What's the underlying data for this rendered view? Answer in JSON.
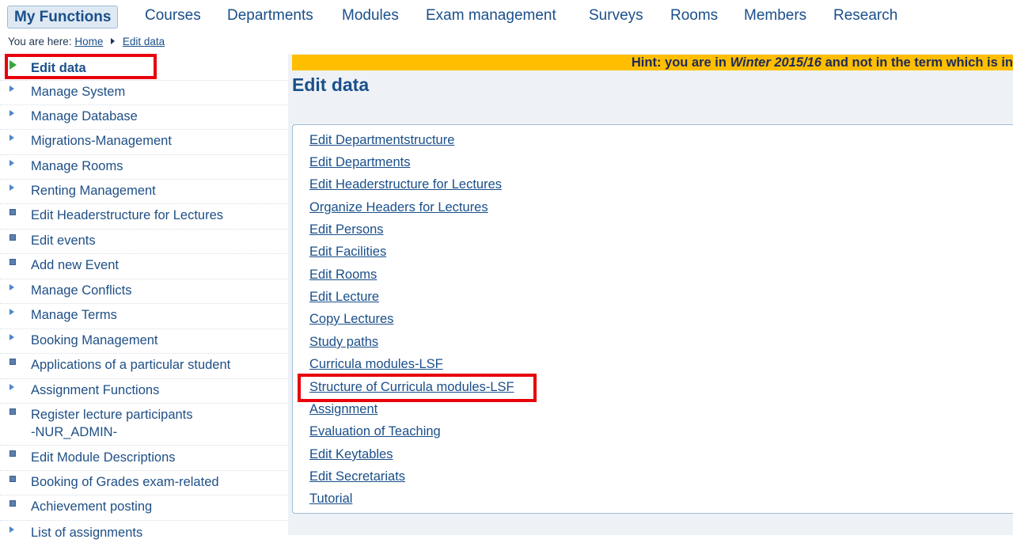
{
  "topnav": {
    "active": "My Functions",
    "items": [
      "Courses",
      "Departments",
      "Modules",
      "Exam management",
      "Surveys",
      "Rooms",
      "Members",
      "Research"
    ]
  },
  "breadcrumb": {
    "prefix": "You are here:",
    "home": "Home",
    "current": "Edit data"
  },
  "sidebar": {
    "items": [
      {
        "label": "Edit data",
        "icon": "green-arrow-icon"
      },
      {
        "label": "Manage System",
        "icon": "triangle-icon"
      },
      {
        "label": "Manage Database",
        "icon": "triangle-icon"
      },
      {
        "label": "Migrations-Management",
        "icon": "triangle-icon"
      },
      {
        "label": "Manage Rooms",
        "icon": "triangle-icon"
      },
      {
        "label": "Renting Management",
        "icon": "triangle-icon"
      },
      {
        "label": "Edit Headerstructure for Lectures",
        "icon": "square-icon"
      },
      {
        "label": "Edit events",
        "icon": "square-icon"
      },
      {
        "label": "Add new Event",
        "icon": "square-icon"
      },
      {
        "label": "Manage Conflicts",
        "icon": "triangle-icon"
      },
      {
        "label": "Manage Terms",
        "icon": "triangle-icon"
      },
      {
        "label": "Booking Management",
        "icon": "triangle-icon"
      },
      {
        "label": "Applications of a particular student",
        "icon": "square-icon"
      },
      {
        "label": "Assignment Functions",
        "icon": "triangle-icon"
      },
      {
        "label": "Register lecture participants",
        "label2": "-NUR_ADMIN-",
        "icon": "square-icon"
      },
      {
        "label": "Edit Module Descriptions",
        "icon": "square-icon"
      },
      {
        "label": "Booking of Grades exam-related",
        "icon": "square-icon"
      },
      {
        "label": "Achievement posting",
        "icon": "square-icon"
      },
      {
        "label": "List of assignments",
        "icon": "triangle-icon"
      }
    ]
  },
  "main": {
    "hint": {
      "before": "Hint: you are in ",
      "term": "Winter 2015/16",
      "after": " and not in the term which is in"
    },
    "title": "Edit data",
    "links": [
      "Edit Departmentstructure",
      "Edit Departments",
      "Edit Headerstructure for Lectures",
      "Organize Headers for Lectures",
      "Edit Persons",
      "Edit Facilities",
      "Edit Rooms",
      "Edit Lecture",
      "Copy Lectures",
      "Study paths",
      "Curricula modules-LSF",
      "Structure of Curricula modules-LSF",
      "Assignment",
      "Evaluation of Teaching",
      "Edit Keytables",
      "Edit Secretariats",
      "Tutorial"
    ]
  },
  "colors": {
    "link": "#1a4f8a",
    "hint_bg": "#ffbf00",
    "highlight": "#e8000b",
    "panel_bg": "#eef2f6"
  }
}
